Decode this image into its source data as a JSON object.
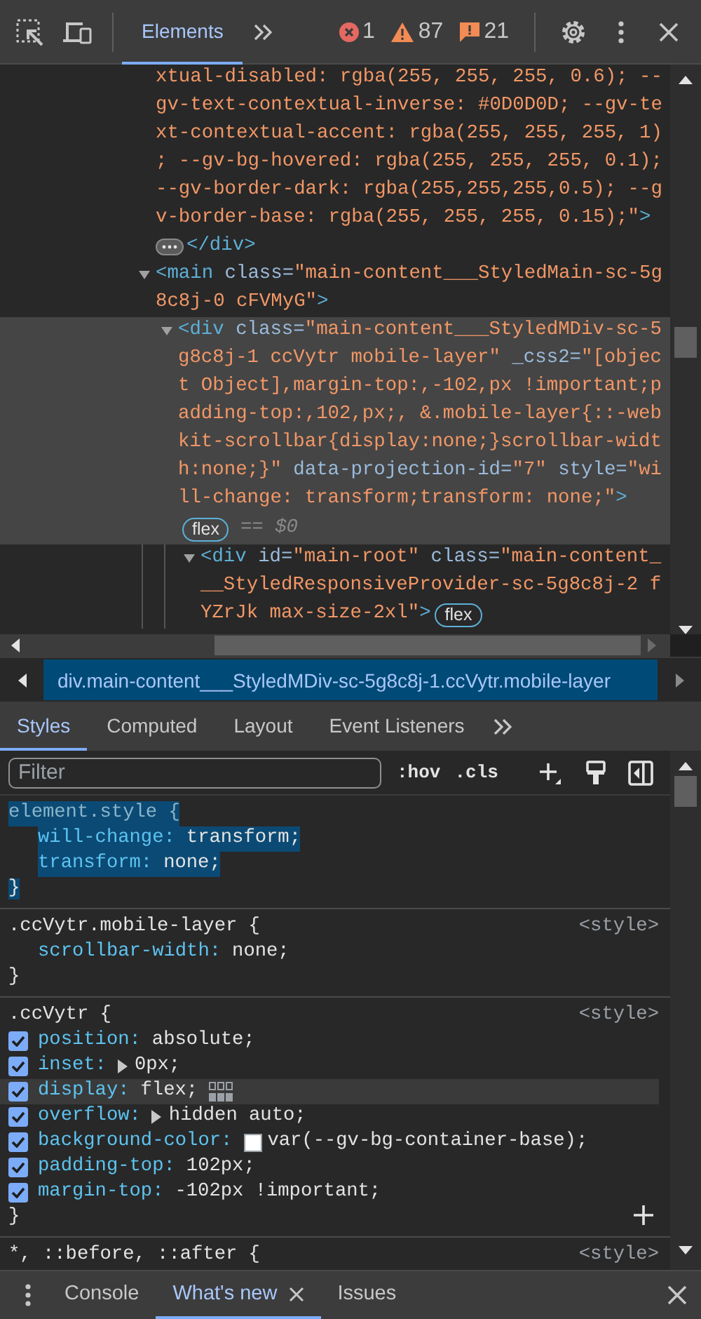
{
  "toolbar": {
    "tabs": [
      {
        "label": "Elements",
        "selected": true
      }
    ],
    "counters": [
      {
        "kind": "error",
        "count": "1"
      },
      {
        "kind": "warning",
        "count": "87"
      },
      {
        "kind": "issue",
        "count": "21"
      }
    ]
  },
  "dom": {
    "nodes": [
      {
        "selected": false,
        "lines": [
          [
            {
              "kind": "value",
              "text": "xtual-disabled: rgba(255, 255, 255, 0.6); --"
            }
          ],
          [
            {
              "kind": "value",
              "text": "gv-text-contextual-inverse: #0D0D0D; --gv-te"
            }
          ],
          [
            {
              "kind": "value",
              "text": "xt-contextual-accent: rgba(255, 255, 255, 1)"
            }
          ],
          [
            {
              "kind": "value",
              "text": "; --gv-bg-hovered: rgba(255, 255, 255, 0.1);"
            }
          ],
          [
            {
              "kind": "value",
              "text": "--gv-border-dark: rgba(255,255,255,0.5); --g"
            }
          ],
          [
            {
              "kind": "value",
              "text": "v-border-base: rgba(255, 255, 255, 0.15);\""
            },
            {
              "kind": "tag",
              "text": ">"
            }
          ],
          [
            {
              "kind": "ellipsis"
            },
            {
              "kind": "tag",
              "text": "</div>"
            }
          ]
        ]
      },
      {
        "selected": false,
        "expanded": true,
        "lines": [
          [
            {
              "kind": "tag",
              "text": "<main"
            },
            {
              "kind": "attr",
              "text": " class="
            },
            {
              "kind": "value",
              "text": "\"main-content___StyledMain-sc-5g"
            }
          ],
          [
            {
              "kind": "value",
              "text": "8c8j-0 cFVMyG\""
            },
            {
              "kind": "tag",
              "text": ">"
            }
          ]
        ],
        "children": [
          {
            "selected": true,
            "expanded": true,
            "lines": [
              [
                {
                  "kind": "tag",
                  "text": "<div"
                },
                {
                  "kind": "attr",
                  "text": " class="
                },
                {
                  "kind": "value",
                  "text": "\"main-content___StyledMDiv-sc-5"
                }
              ],
              [
                {
                  "kind": "value",
                  "text": "g8c8j-1 ccVytr mobile-layer\""
                },
                {
                  "kind": "attr",
                  "text": " _css2="
                },
                {
                  "kind": "value",
                  "text": "\"[objec"
                }
              ],
              [
                {
                  "kind": "value",
                  "text": "t Object],margin-top:,-102,px !important;p"
                }
              ],
              [
                {
                  "kind": "value",
                  "text": "adding-top:,102,px;, &.mobile-layer{::-web"
                }
              ],
              [
                {
                  "kind": "value",
                  "text": "kit-scrollbar{display:none;}scrollbar-widt"
                }
              ],
              [
                {
                  "kind": "value",
                  "text": "h:none;}\""
                },
                {
                  "kind": "attr",
                  "text": " data-projection-id="
                },
                {
                  "kind": "value",
                  "text": "\"7\""
                },
                {
                  "kind": "attr",
                  "text": " style="
                },
                {
                  "kind": "value",
                  "text": "\"wi"
                }
              ],
              [
                {
                  "kind": "value",
                  "text": "ll-change: transform;transform: none;\""
                },
                {
                  "kind": "tag",
                  "text": ">"
                }
              ],
              [
                {
                  "kind": "badge",
                  "text": "flex"
                },
                {
                  "kind": "ref",
                  "text": "== $0"
                }
              ]
            ],
            "children": [
              {
                "selected": false,
                "expanded": true,
                "lines": [
                  [
                    {
                      "kind": "tag",
                      "text": "<div"
                    },
                    {
                      "kind": "attr",
                      "text": " id="
                    },
                    {
                      "kind": "value",
                      "text": "\"main-root\""
                    },
                    {
                      "kind": "attr",
                      "text": " class="
                    },
                    {
                      "kind": "value",
                      "text": "\"main-content_"
                    }
                  ],
                  [
                    {
                      "kind": "value",
                      "text": "__StyledResponsiveProvider-sc-5g8c8j-2 f"
                    }
                  ],
                  [
                    {
                      "kind": "value",
                      "text": "YZrJk max-size-2xl\""
                    },
                    {
                      "kind": "tag",
                      "text": ">"
                    },
                    {
                      "kind": "badge",
                      "text": "flex"
                    }
                  ]
                ]
              }
            ]
          }
        ]
      }
    ]
  },
  "breadcrumbs": [
    {
      "label": "div.main-content___StyledMDiv-sc-5g8c8j-1.ccVytr.mobile-layer",
      "selected": true
    }
  ],
  "subtabs": [
    {
      "label": "Styles",
      "selected": true
    },
    {
      "label": "Computed",
      "selected": false
    },
    {
      "label": "Layout",
      "selected": false
    },
    {
      "label": "Event Listeners",
      "selected": false
    }
  ],
  "filter": {
    "placeholder": "Filter",
    "buttons": [
      ":hov",
      ".cls"
    ]
  },
  "rules": [
    {
      "selector": "element.style {",
      "selected": true,
      "close": "}",
      "props": [
        {
          "name": "will-change:",
          "value": "transform;"
        },
        {
          "name": "transform:",
          "value": "none;"
        }
      ]
    },
    {
      "selector": ".ccVytr.mobile-layer {",
      "source": "<style>",
      "selected": false,
      "close": "}",
      "props": [
        {
          "name": "scrollbar-width:",
          "value": "none;"
        }
      ]
    },
    {
      "selector": ".ccVytr {",
      "source": "<style>",
      "selected": false,
      "close": "}",
      "add_button": true,
      "props": [
        {
          "name": "position:",
          "value": "absolute;",
          "checked": true,
          "hovered": false
        },
        {
          "name": "inset:",
          "value": "0px;",
          "checked": true,
          "hovered": false,
          "expandable": true
        },
        {
          "name": "display:",
          "value": "flex;",
          "checked": true,
          "hovered": true,
          "flex_editor": true
        },
        {
          "name": "overflow:",
          "value": "hidden auto;",
          "checked": true,
          "hovered": false,
          "expandable": true
        },
        {
          "name": "background-color:",
          "value": "var(--gv-bg-container-base);",
          "checked": true,
          "hovered": false,
          "color": "#ffffff"
        },
        {
          "name": "padding-top:",
          "value": "102px;",
          "checked": true,
          "hovered": false
        },
        {
          "name": "margin-top:",
          "value": "-102px !important;",
          "checked": true,
          "hovered": false
        }
      ]
    },
    {
      "selector": "*, ::before, ::after {",
      "source": "<style>",
      "selected": false
    }
  ],
  "drawer": {
    "tabs": [
      {
        "label": "Console",
        "selected": false
      },
      {
        "label": "What's new",
        "selected": true,
        "closable": true
      },
      {
        "label": "Issues",
        "selected": false
      }
    ]
  }
}
